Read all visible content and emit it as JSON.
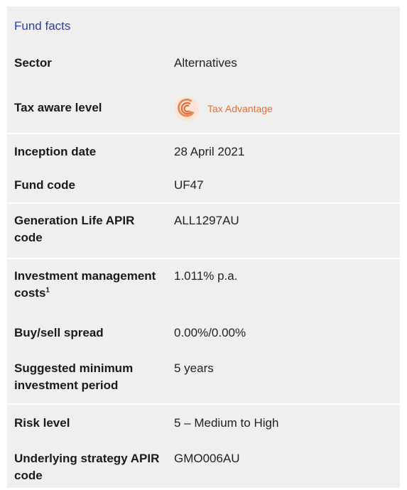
{
  "title": "Fund facts",
  "rows": [
    {
      "label": "Sector",
      "value": "Alternatives"
    },
    {
      "label": "Tax aware level",
      "value": "Tax Advantage"
    },
    {
      "label": "Inception date",
      "value": "28 April 2021"
    },
    {
      "label": "Fund code",
      "value": "UF47"
    },
    {
      "label": "Generation Life APIR code",
      "value": "ALL1297AU"
    },
    {
      "label": "Investment management costs",
      "footnote": "1",
      "value": "1.011% p.a."
    },
    {
      "label": "Buy/sell spread",
      "value": "0.00%/0.00%"
    },
    {
      "label": "Suggested minimum investment period",
      "value": "5 years"
    },
    {
      "label": "Risk level",
      "value": "5 – Medium to High"
    },
    {
      "label": "Underlying strategy APIR code",
      "value": "GMO006AU"
    }
  ],
  "colors": {
    "title": "#2b3f9e",
    "panel_background": "#efeff0",
    "tax_badge": "#e0703a"
  },
  "icons": {
    "tax_advantage": "tax-advantage-ring-icon"
  }
}
